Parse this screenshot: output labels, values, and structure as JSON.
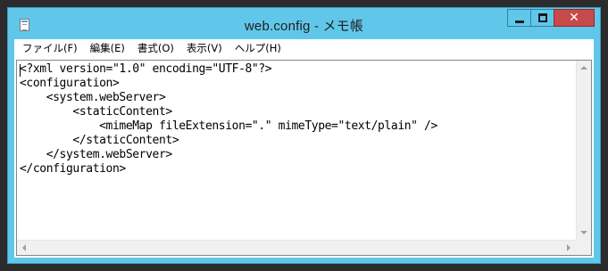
{
  "window": {
    "title": "web.config - メモ帳",
    "icon": "notepad-icon",
    "close_glyph": "✕"
  },
  "menu": {
    "items": [
      {
        "label": "ファイル(F)"
      },
      {
        "label": "編集(E)"
      },
      {
        "label": "書式(O)"
      },
      {
        "label": "表示(V)"
      },
      {
        "label": "ヘルプ(H)"
      }
    ]
  },
  "editor": {
    "lines": [
      "<?xml version=\"1.0\" encoding=\"UTF-8\"?>",
      "<configuration>",
      "    <system.webServer>",
      "        <staticContent>",
      "            <mimeMap fileExtension=\".\" mimeType=\"text/plain\" />",
      "        </staticContent>",
      "    </system.webServer>",
      "</configuration>"
    ]
  },
  "colors": {
    "titlebar": "#61c7ea",
    "close_button": "#c74a4a",
    "background": "#2b2b2b"
  }
}
